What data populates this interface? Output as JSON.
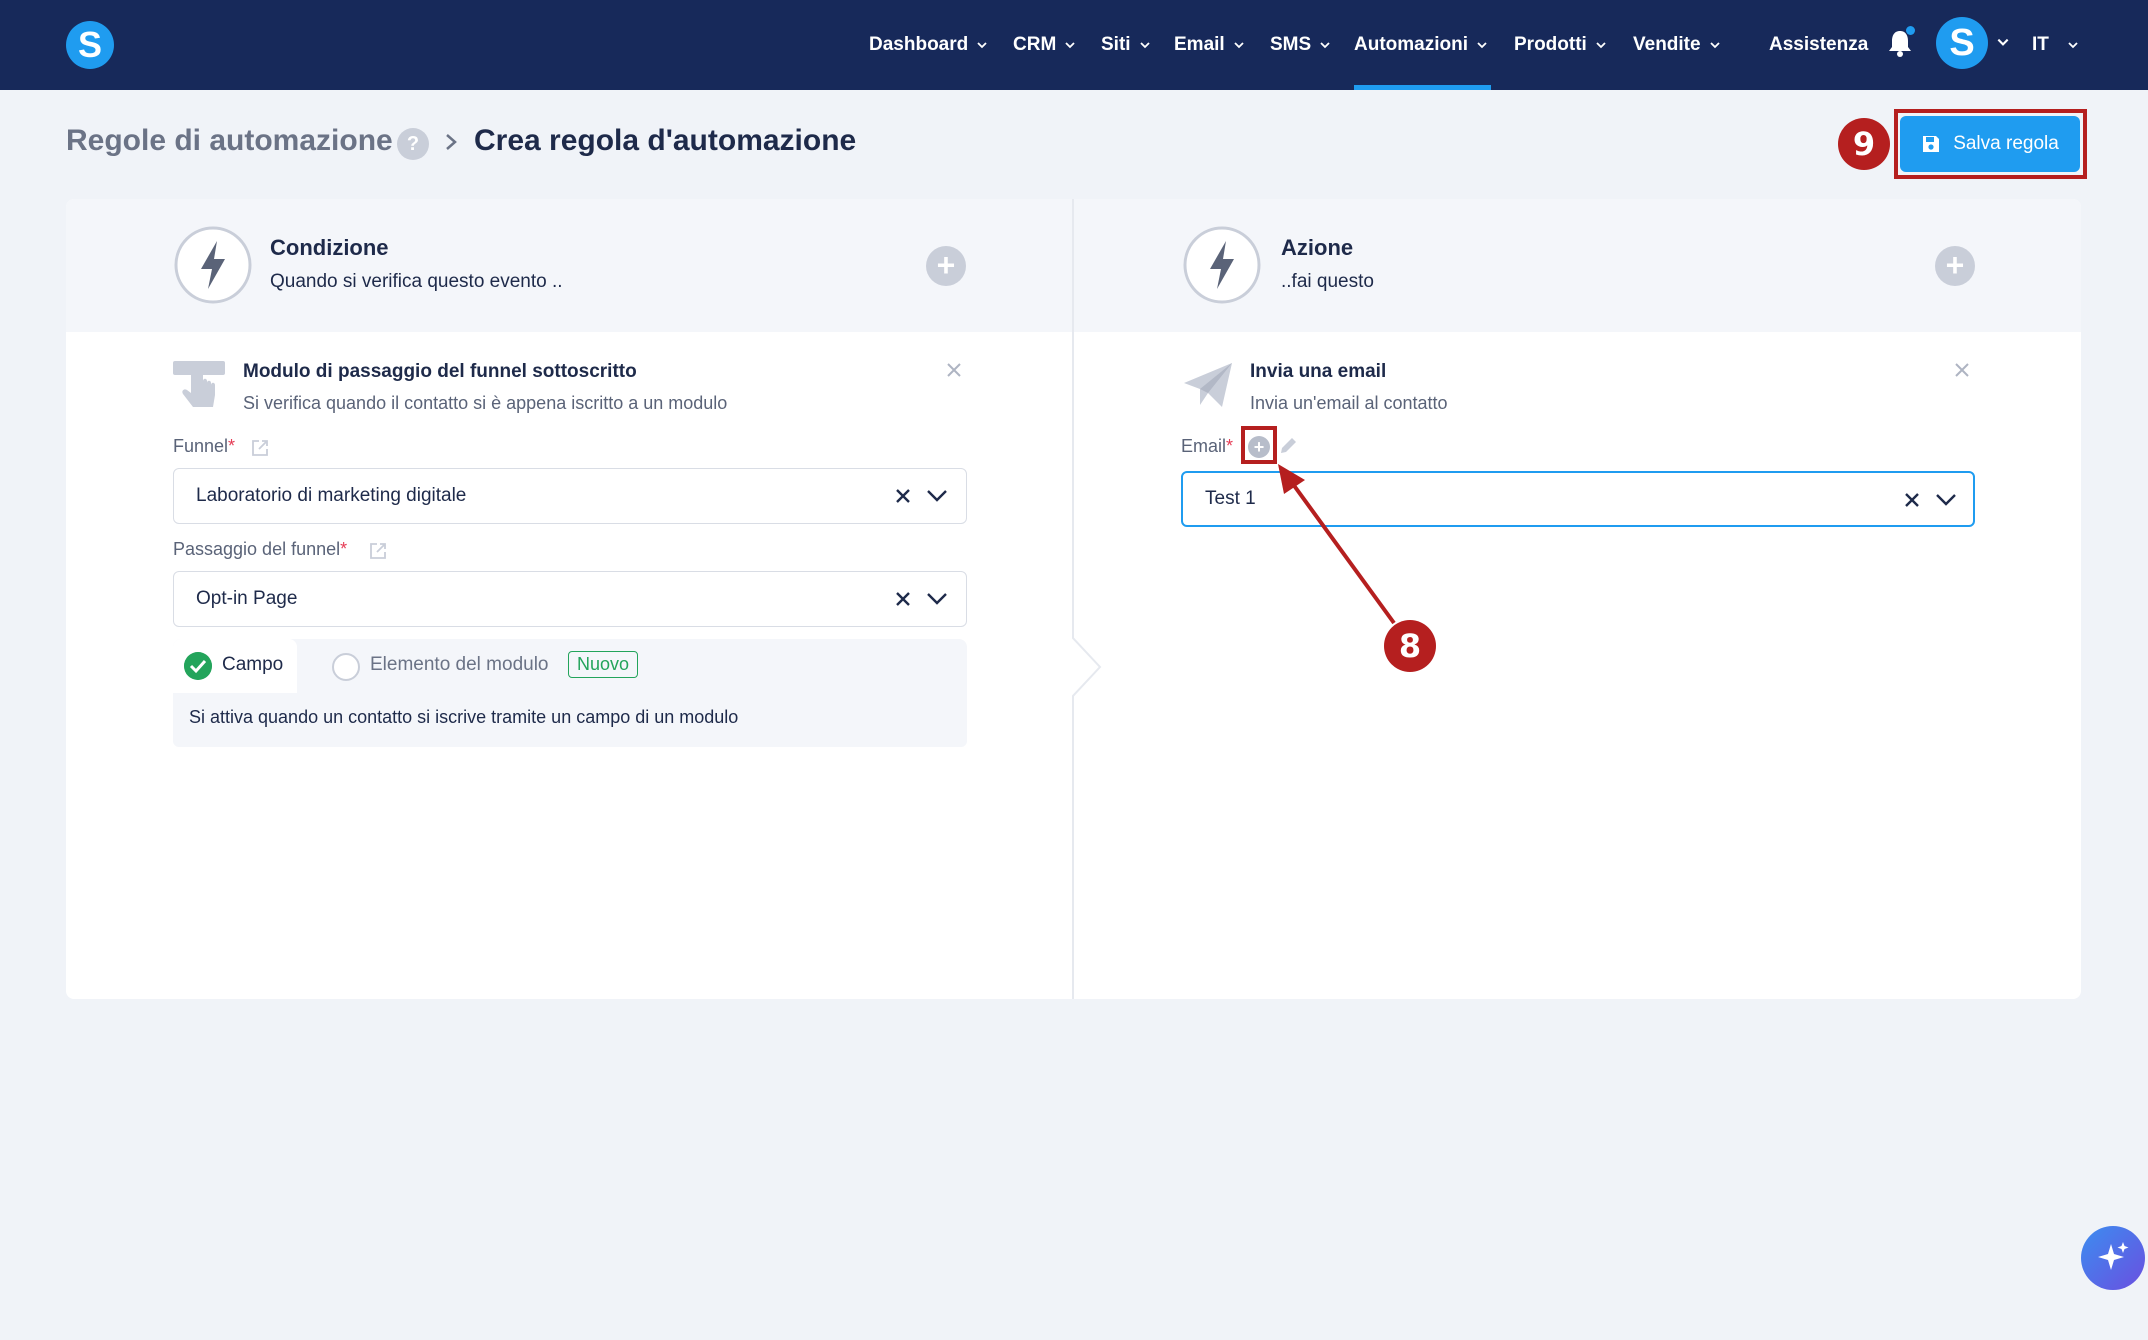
{
  "nav": {
    "logo": "S",
    "items": [
      {
        "label": "Dashboard"
      },
      {
        "label": "CRM"
      },
      {
        "label": "Siti"
      },
      {
        "label": "Email"
      },
      {
        "label": "SMS"
      },
      {
        "label": "Automazioni",
        "active": true
      },
      {
        "label": "Prodotti"
      },
      {
        "label": "Vendite"
      }
    ],
    "help": "Assistenza",
    "avatar": "S",
    "language": "IT"
  },
  "header": {
    "breadcrumb_root": "Regole di automazione",
    "help_badge": "?",
    "title": "Crea regola d'automazione",
    "save_label": "Salva regola"
  },
  "annotations": {
    "step_save": "9",
    "step_email_add": "8"
  },
  "condition": {
    "title": "Condizione",
    "subtitle": "Quando si verifica questo evento ..",
    "block_title": "Modulo di passaggio del funnel sottoscritto",
    "block_sub": "Si verifica quando il contatto si è appena iscritto a un modulo",
    "funnel_label": "Funnel",
    "funnel_value": "Laboratorio di marketing digitale",
    "step_label": "Passaggio del funnel",
    "step_value": "Opt-in Page",
    "option_field": "Campo",
    "option_element": "Elemento del modulo",
    "new_badge": "Nuovo",
    "info": "Si attiva quando un contatto si iscrive tramite un campo di un modulo"
  },
  "action": {
    "title": "Azione",
    "subtitle": "..fai questo",
    "block_title": "Invia una email",
    "block_sub": "Invia un'email al contatto",
    "email_label": "Email",
    "email_value": "Test 1"
  },
  "colors": {
    "nav_bg": "#17295a",
    "accent": "#1f9cf0",
    "annotation_red": "#b51f1f",
    "success_green": "#23a45b"
  }
}
